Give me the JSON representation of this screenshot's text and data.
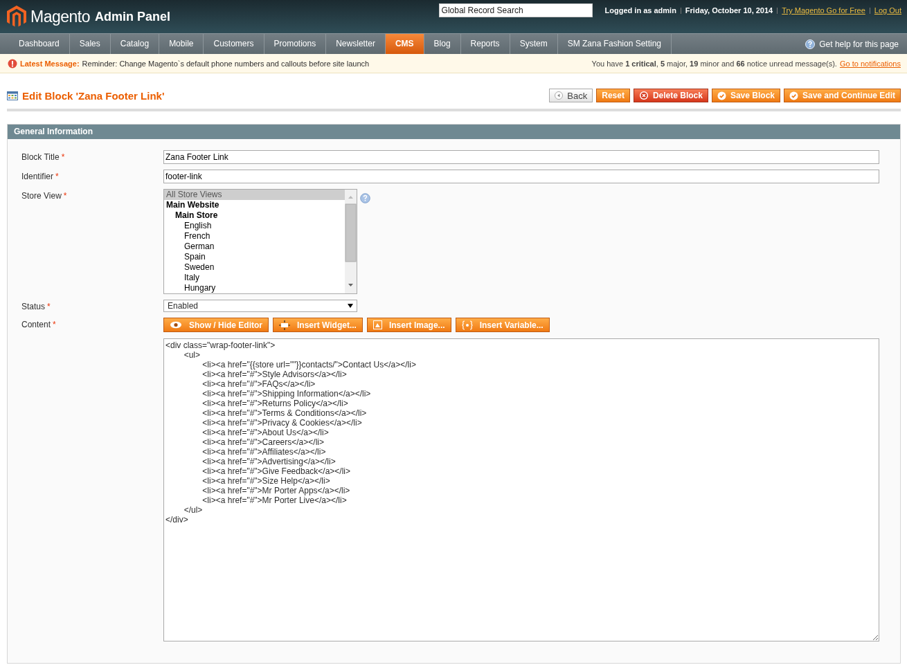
{
  "header": {
    "logo_text": "Magento",
    "logo_suffix": "Admin Panel",
    "search": {
      "placeholder": "Global Record Search"
    },
    "user_text": "Logged in as admin",
    "date": "Friday, October 10, 2014",
    "links": [
      "Try Magento Go for Free",
      "Log Out"
    ]
  },
  "nav": {
    "items": [
      {
        "label": "Dashboard",
        "selected": false
      },
      {
        "label": "Sales",
        "selected": false
      },
      {
        "label": "Catalog",
        "selected": false
      },
      {
        "label": "Mobile",
        "selected": false
      },
      {
        "label": "Customers",
        "selected": false
      },
      {
        "label": "Promotions",
        "selected": false
      },
      {
        "label": "Newsletter",
        "selected": false
      },
      {
        "label": "CMS",
        "selected": true
      },
      {
        "label": "Blog",
        "selected": false
      },
      {
        "label": "Reports",
        "selected": false
      },
      {
        "label": "System",
        "selected": false
      },
      {
        "label": "SM Zana Fashion Setting",
        "selected": false
      }
    ],
    "help": "Get help for this page"
  },
  "message_bar": {
    "label": "Latest Message:",
    "text": "Reminder: Change Magento`s default phone numbers and callouts before site launch",
    "summary": "You have **1 critical**, **5** major, **19** minor and **66** notice unread message(s).",
    "link": "Go to notifications"
  },
  "page": {
    "title": "Edit Block 'Zana Footer Link'",
    "buttons": [
      {
        "kind": "back",
        "label": "Back"
      },
      {
        "kind": "reset",
        "label": "Reset"
      },
      {
        "kind": "delete",
        "label": "Delete Block"
      },
      {
        "kind": "save",
        "label": "Save Block"
      },
      {
        "kind": "save",
        "label": "Save and Continue Edit"
      }
    ]
  },
  "section": {
    "title": "General Information",
    "fields": [
      {
        "kind": "text",
        "label": "Block Title",
        "required_mark": "*",
        "value": "Zana Footer Link"
      },
      {
        "kind": "text",
        "label": "Identifier",
        "required_mark": "*",
        "value": "footer-link"
      },
      {
        "kind": "multiselect",
        "label": "Store View",
        "required_mark": "*",
        "options": [
          {
            "label": "All Store Views",
            "selected": true
          },
          {
            "label": "Main Website",
            "selected": false,
            "children": [
              {
                "label": "Main Store",
                "selected": false,
                "children": [
                  {
                    "label": "English",
                    "selected": false
                  },
                  {
                    "label": "French",
                    "selected": false
                  },
                  {
                    "label": "German",
                    "selected": false
                  },
                  {
                    "label": "Spain",
                    "selected": false
                  },
                  {
                    "label": "Sweden",
                    "selected": false
                  },
                  {
                    "label": "Italy",
                    "selected": false
                  },
                  {
                    "label": "Hungary",
                    "selected": false
                  }
                ]
              }
            ]
          }
        ]
      },
      {
        "kind": "select",
        "label": "Status",
        "required_mark": "*",
        "value": "Enabled"
      },
      {
        "kind": "editor",
        "label": "Content",
        "required_mark": "*",
        "toolbar": [
          {
            "kind": "eye",
            "label": "Show / Hide Editor"
          },
          {
            "kind": "widget",
            "label": "Insert Widget..."
          },
          {
            "kind": "image",
            "label": "Insert Image..."
          },
          {
            "kind": "variable",
            "label": "Insert Variable..."
          }
        ],
        "value": "<div class=\"wrap-footer-link\">\n\t<ul>\n\t\t<li><a href=\"{{store url=\"\"}}contacts/\">Contact Us</a></li>\n\t\t<li><a href=\"#\">Style Advisors</a></li>\n\t\t<li><a href=\"#\">FAQs</a></li>\n\t\t<li><a href=\"#\">Shipping Information</a></li>\n\t\t<li><a href=\"#\">Returns Policy</a></li>\n\t\t<li><a href=\"#\">Terms & Conditions</a></li>\n\t\t<li><a href=\"#\">Privacy & Cookies</a></li>\n\t\t<li><a href=\"#\">About Us</a></li>\n\t\t<li><a href=\"#\">Careers</a></li>\n\t\t<li><a href=\"#\">Affiliates</a></li>\n\t\t<li><a href=\"#\">Advertising</a></li>\n\t\t<li><a href=\"#\">Give Feedback</a></li>\n\t\t<li><a href=\"#\">Size Help</a></li>\n\t\t<li><a href=\"#\">Mr Porter Apps</a></li>\n\t\t<li><a href=\"#\">Mr Porter Live</a></li>\n\t</ul>\n</div>"
      }
    ]
  }
}
